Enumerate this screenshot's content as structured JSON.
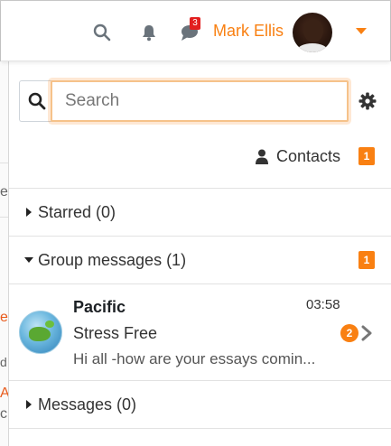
{
  "navbar": {
    "user_name": "Mark Ellis",
    "messages_badge": "3",
    "accent_color": "#f98012",
    "icons": [
      "search-icon",
      "bell-icon",
      "chat-icon",
      "caret-down-icon"
    ]
  },
  "drawer": {
    "search": {
      "placeholder": "Search"
    },
    "contacts": {
      "label": "Contacts",
      "badge": "1"
    },
    "sections": {
      "starred": {
        "label": "Starred (0)"
      },
      "group": {
        "label": "Group messages (1)",
        "badge": "1"
      },
      "messages": {
        "label": "Messages (0)"
      }
    },
    "conversation": {
      "name": "Pacific",
      "time": "03:58",
      "subject": "Stress Free",
      "preview": "Hi all -how are your essays comin...",
      "unread": "2"
    }
  },
  "background": {
    "chars": [
      "e",
      "el",
      "d",
      "A",
      "c"
    ]
  }
}
